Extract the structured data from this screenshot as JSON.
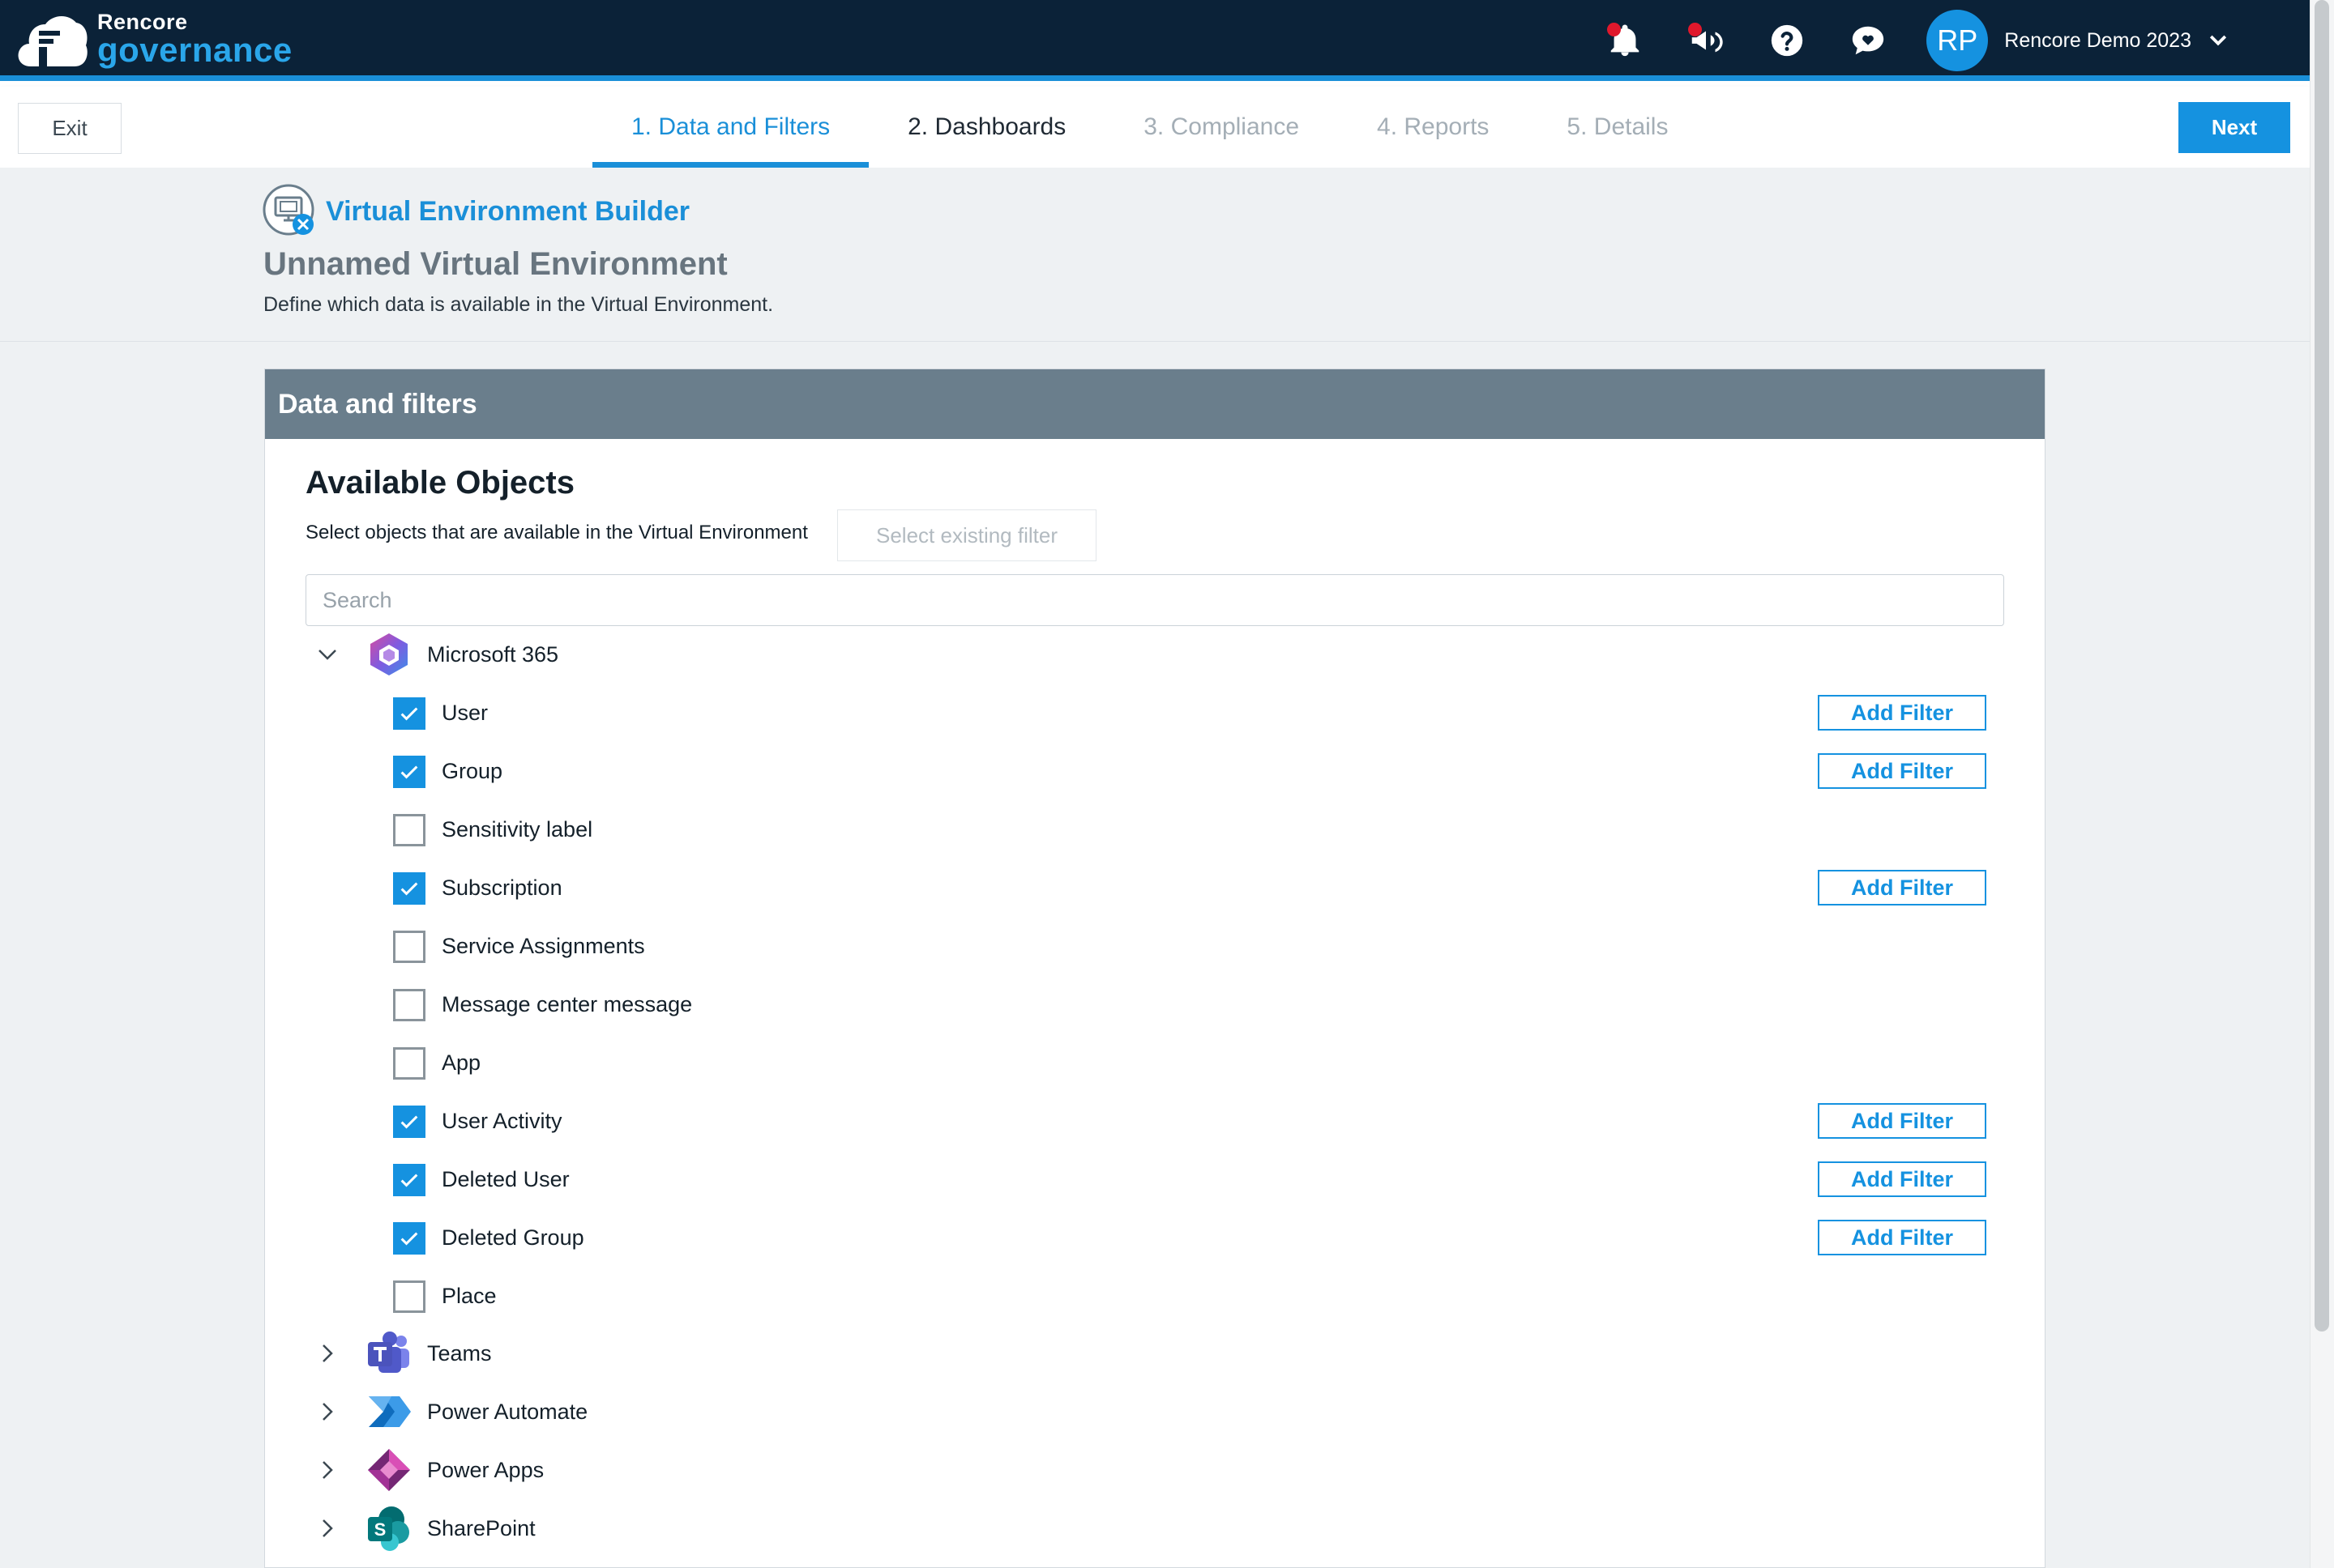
{
  "brand": {
    "line1": "Rencore",
    "line2": "governance"
  },
  "topbar": {
    "icons": [
      "notification-bell-icon",
      "announcement-megaphone-icon",
      "help-question-icon",
      "feedback-chat-icon"
    ],
    "user": {
      "initials": "RP",
      "tenant": "Rencore Demo 2023"
    }
  },
  "toolbar": {
    "exit_label": "Exit",
    "next_label": "Next"
  },
  "steps": [
    {
      "label": "1. Data and Filters",
      "state": "active"
    },
    {
      "label": "2. Dashboards",
      "state": "visited"
    },
    {
      "label": "3. Compliance",
      "state": "disabled"
    },
    {
      "label": "4. Reports",
      "state": "disabled"
    },
    {
      "label": "5. Details",
      "state": "disabled"
    }
  ],
  "header": {
    "builder_title": "Virtual Environment Builder",
    "env_name": "Unnamed Virtual Environment",
    "description": "Define which data is available in the Virtual Environment."
  },
  "panel": {
    "title": "Data and filters",
    "available_title": "Available Objects",
    "available_desc": "Select objects that are available in the Virtual Environment",
    "existing_filter_label": "Select existing filter",
    "search_placeholder": "Search"
  },
  "tree": {
    "expanded": {
      "label": "Microsoft 365",
      "icon": "microsoft-365-logo-icon",
      "items": [
        {
          "label": "User",
          "checked": true,
          "filter_label": "Add Filter"
        },
        {
          "label": "Group",
          "checked": true,
          "filter_label": "Add Filter"
        },
        {
          "label": "Sensitivity label",
          "checked": false
        },
        {
          "label": "Subscription",
          "checked": true,
          "filter_label": "Add Filter"
        },
        {
          "label": "Service Assignments",
          "checked": false
        },
        {
          "label": "Message center message",
          "checked": false
        },
        {
          "label": "App",
          "checked": false
        },
        {
          "label": "User Activity",
          "checked": true,
          "filter_label": "Add Filter"
        },
        {
          "label": "Deleted User",
          "checked": true,
          "filter_label": "Add Filter"
        },
        {
          "label": "Deleted Group",
          "checked": true,
          "filter_label": "Add Filter"
        },
        {
          "label": "Place",
          "checked": false
        }
      ]
    },
    "collapsed": [
      {
        "label": "Teams",
        "icon": "teams-logo-icon"
      },
      {
        "label": "Power Automate",
        "icon": "power-automate-logo-icon"
      },
      {
        "label": "Power Apps",
        "icon": "power-apps-logo-icon"
      },
      {
        "label": "SharePoint",
        "icon": "sharepoint-logo-icon"
      }
    ]
  },
  "colors": {
    "topbar": "#0b2238",
    "accent": "#1592e0",
    "panel_header": "#6a7e8c",
    "page_bg": "#eef1f3"
  }
}
